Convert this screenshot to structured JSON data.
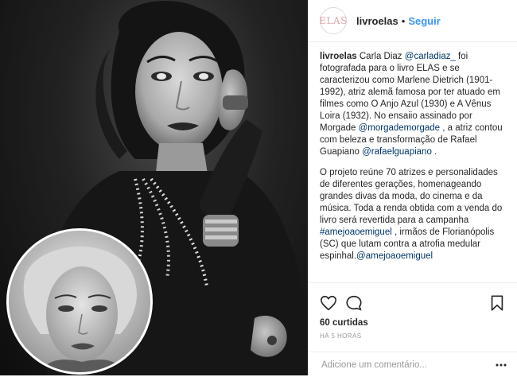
{
  "header": {
    "avatar_text": "ELAS",
    "username": "livroelas",
    "separator": "•",
    "follow_label": "Seguir"
  },
  "caption": {
    "username": "livroelas",
    "p1_text1": "Carla Diaz ",
    "mention_carla": "@carladiaz_",
    "p1_text2": " foi fotografada para o livro ELAS e se caracterizou como Marlene Dietrich (1901-1992), atriz alemã famosa por ter atuado em filmes como O Anjo Azul (1930) e A Vênus Loira (1932). No ensaiio assinado por Morgade ",
    "mention_morgade": "@morgademorgade",
    "p1_text3": " , a atriz contou com beleza e transformação de Rafael Guapiano ",
    "mention_rafael": "@rafaelguapiano",
    "p1_text4": " .",
    "p2_text1": "O projeto reúne 70 atrizes e personalidades de diferentes gerações, homenageando grandes divas da moda, do cinema e da música. Toda a renda obtida com a venda do livro será revertida para a campanha ",
    "hashtag": "#amejoaoemiguel",
    "p2_text2": " , irmãos de Florianópolis (SC) que lutam contra a atrofia medular espinhal.",
    "mention_amejoao": "@amejoaoemiguel"
  },
  "actions": {
    "like_icon": "heart-icon",
    "comment_icon": "comment-bubble-icon",
    "save_icon": "bookmark-icon",
    "likes_count": "60 curtidas",
    "time_ago": "HÁ 5 HORAS"
  },
  "comment": {
    "placeholder": "Adicione um comentário...",
    "more_icon": "more-dots-icon"
  },
  "colors": {
    "link": "#003569",
    "follow": "#3897f0",
    "muted": "#999999",
    "border": "#efefef"
  }
}
